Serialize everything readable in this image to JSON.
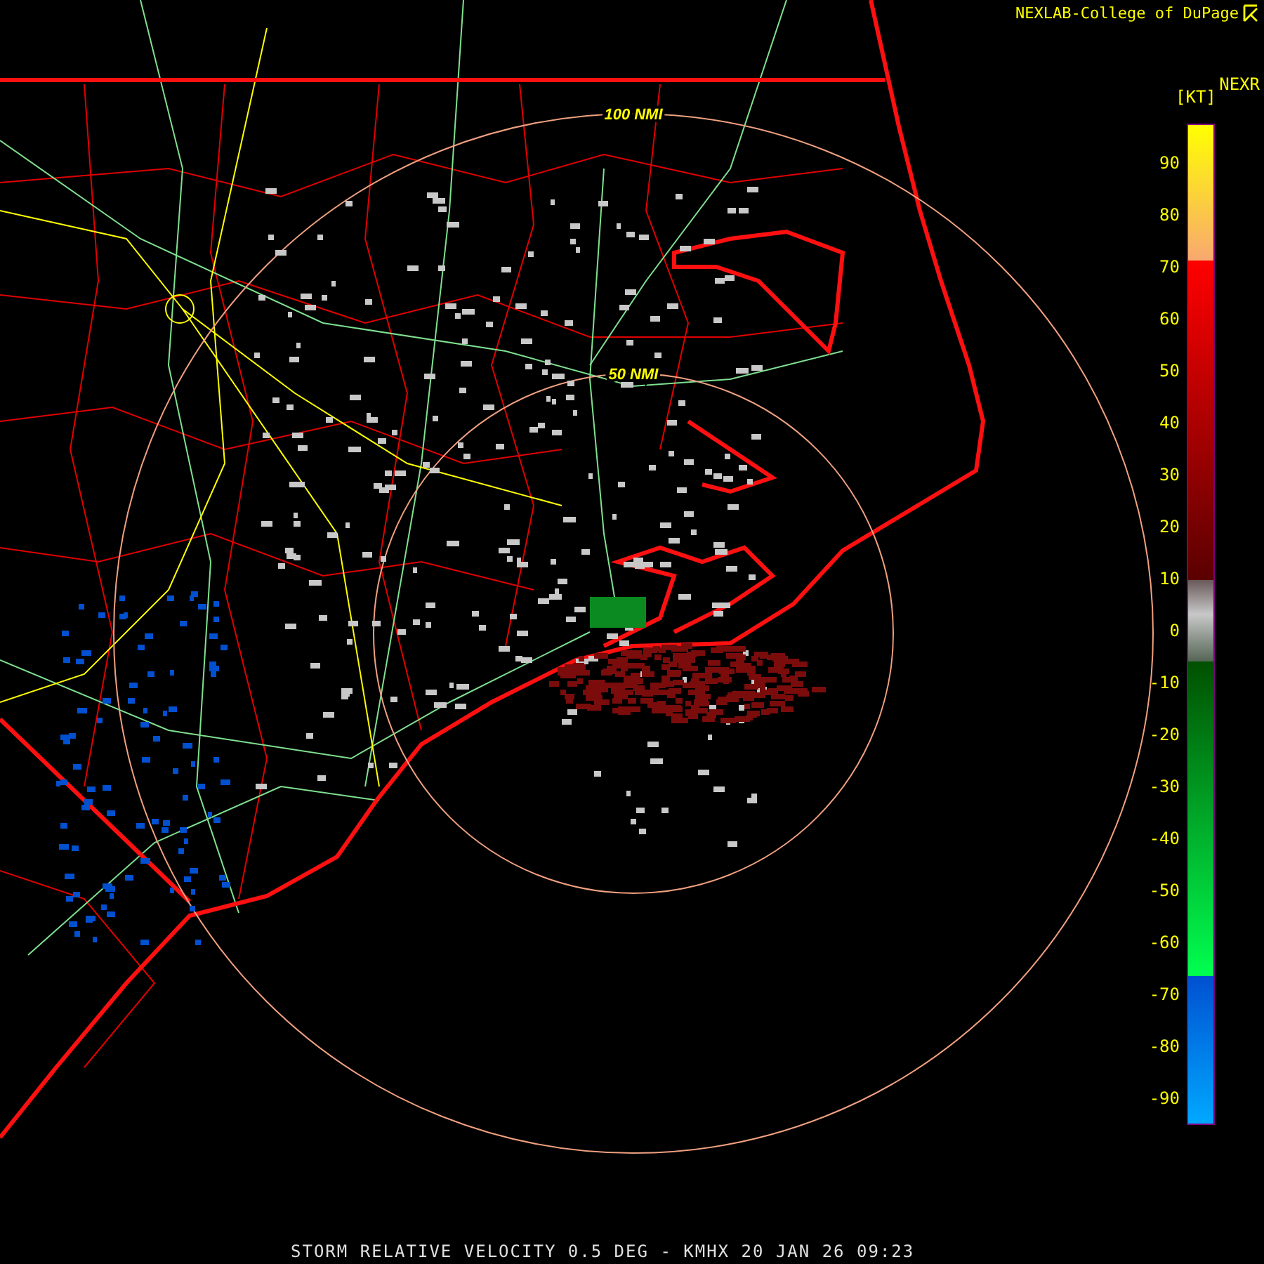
{
  "header": {
    "credit": "NEXLAB-College of DuPage"
  },
  "map": {
    "range_rings": [
      {
        "label": "100 NMI"
      },
      {
        "label": "50 NMI"
      }
    ]
  },
  "legend": {
    "product": "NEXR",
    "unit": "[KT]",
    "ticks": [
      "90",
      "80",
      "70",
      "60",
      "50",
      "40",
      "30",
      "20",
      "10",
      "0",
      "-10",
      "-20",
      "-30",
      "-40",
      "-50",
      "-60",
      "-70",
      "-80",
      "-90"
    ]
  },
  "title": "STORM RELATIVE VELOCITY 0.5 DEG - KMHX 20 JAN 26 09:23"
}
